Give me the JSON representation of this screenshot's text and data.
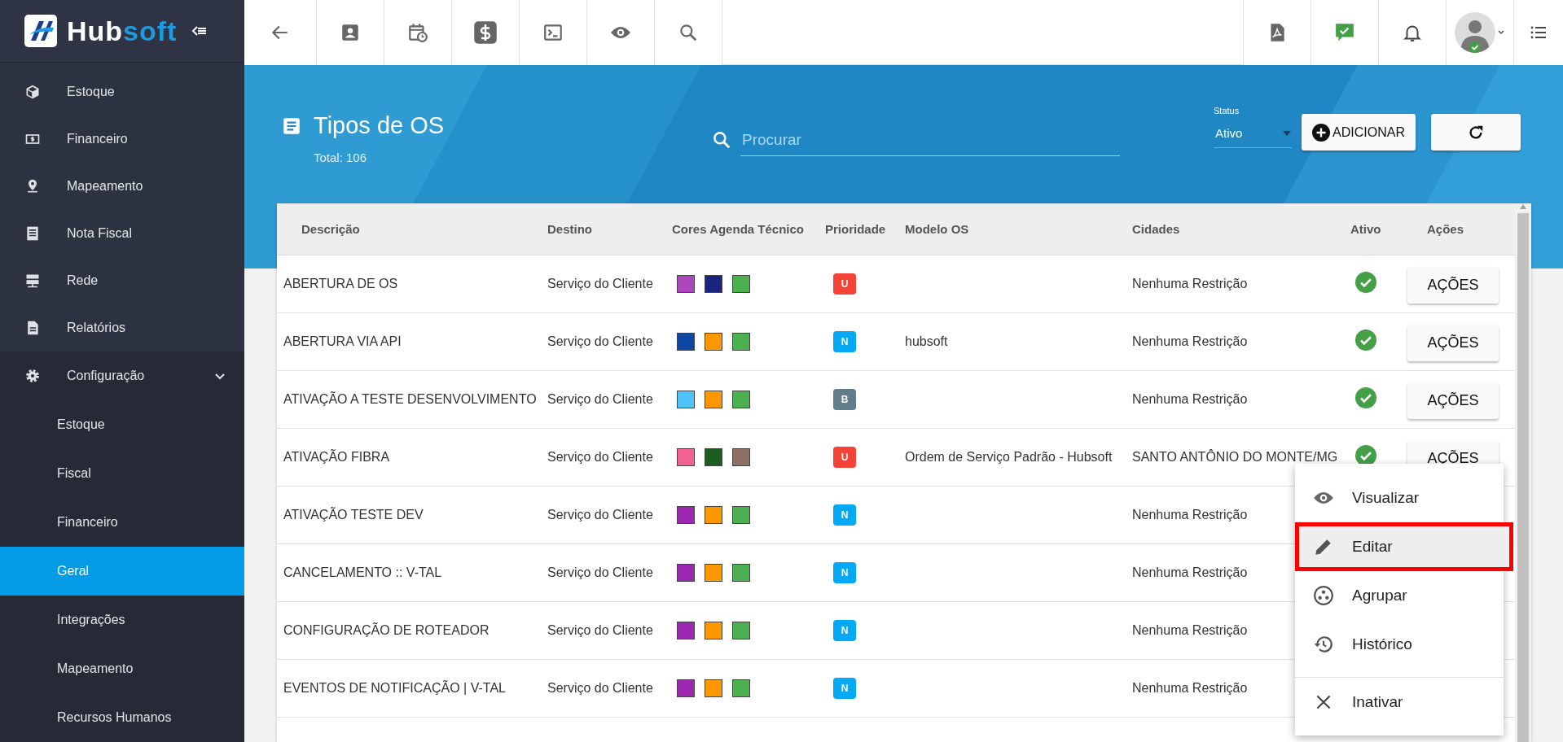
{
  "sidebar": {
    "brand": {
      "part_1": "Hub",
      "part_2": "soft"
    },
    "items": [
      {
        "label": "Estoque",
        "kind": "box",
        "selected": false
      },
      {
        "label": "Financeiro",
        "kind": "money",
        "selected": false
      },
      {
        "label": "Mapeamento",
        "kind": "pin",
        "selected": false
      },
      {
        "label": "Nota Fiscal",
        "kind": "receipt",
        "selected": false
      },
      {
        "label": "Rede",
        "kind": "server",
        "selected": false
      },
      {
        "label": "Relatórios",
        "kind": "doc",
        "selected": false
      },
      {
        "label": "Configuração",
        "kind": "gear",
        "selected": false,
        "expanded": true,
        "children": [
          {
            "label": "Estoque",
            "selected": false
          },
          {
            "label": "Fiscal",
            "selected": false
          },
          {
            "label": "Financeiro",
            "selected": false
          },
          {
            "label": "Geral",
            "selected": true
          },
          {
            "label": "Integrações",
            "selected": false
          },
          {
            "label": "Mapeamento",
            "selected": false
          },
          {
            "label": "Recursos Humanos",
            "selected": false
          }
        ]
      }
    ]
  },
  "header": {
    "title": "Tipos de OS",
    "total": "Total: 106",
    "search": {
      "placeholder": "Procurar"
    },
    "status": {
      "label": "Status",
      "value": "Ativo"
    },
    "add_button": "ADICIONAR"
  },
  "table": {
    "columns": [
      "Descrição",
      "Destino",
      "Cores Agenda Técnico",
      "Prioridade",
      "Modelo OS",
      "Cidades",
      "Ativo",
      "Ações"
    ],
    "rows": [
      {
        "description": "ABERTURA DE OS",
        "destination": "Serviço do Cliente",
        "colors": [
          {
            "color": "#ab47bc"
          },
          {
            "color": "#1a237e"
          },
          {
            "color": "#4caf50"
          }
        ],
        "priority": {
          "label": "U",
          "color": "#f44336"
        },
        "model": "",
        "cities": "Nenhuma Restrição",
        "active": true,
        "action": "AÇÕES"
      },
      {
        "description": "ABERTURA VIA API",
        "destination": "Serviço do Cliente",
        "colors": [
          {
            "color": "#0d47a1"
          },
          {
            "color": "#ff9800"
          },
          {
            "color": "#4caf50"
          }
        ],
        "priority": {
          "label": "N",
          "color": "#03a9f4"
        },
        "model": "hubsoft",
        "cities": "Nenhuma Restrição",
        "active": true,
        "action": "AÇÕES"
      },
      {
        "description": "ATIVAÇÃO A TESTE DESENVOLVIMENTO",
        "destination": "Serviço do Cliente",
        "colors": [
          {
            "color": "#4fc3f7"
          },
          {
            "color": "#ff9800"
          },
          {
            "color": "#4caf50"
          }
        ],
        "priority": {
          "label": "B",
          "color": "#607d8b"
        },
        "model": "",
        "cities": "Nenhuma Restrição",
        "active": true,
        "action": "AÇÕES"
      },
      {
        "description": "ATIVAÇÃO FIBRA",
        "destination": "Serviço do Cliente",
        "colors": [
          {
            "color": "#f06292"
          },
          {
            "color": "#1b5e20"
          },
          {
            "color": "#8d6e63"
          }
        ],
        "priority": {
          "label": "U",
          "color": "#f44336"
        },
        "model": "Ordem de Serviço Padrão - Hubsoft",
        "cities": "SANTO ANTÔNIO DO MONTE/MG",
        "active": true,
        "action": "AÇÕES"
      },
      {
        "description": "ATIVAÇÃO TESTE DEV",
        "destination": "Serviço do Cliente",
        "colors": [
          {
            "color": "#9c27b0"
          },
          {
            "color": "#ff9800"
          },
          {
            "color": "#4caf50"
          }
        ],
        "priority": {
          "label": "N",
          "color": "#03a9f4"
        },
        "model": "",
        "cities": "Nenhuma Restrição"
      },
      {
        "description": "CANCELAMENTO :: V-TAL",
        "destination": "Serviço do Cliente",
        "colors": [
          {
            "color": "#9c27b0"
          },
          {
            "color": "#ff9800"
          },
          {
            "color": "#4caf50"
          }
        ],
        "priority": {
          "label": "N",
          "color": "#03a9f4"
        },
        "model": "",
        "cities": "Nenhuma Restrição"
      },
      {
        "description": "CONFIGURAÇÃO DE ROTEADOR",
        "destination": "Serviço do Cliente",
        "colors": [
          {
            "color": "#9c27b0"
          },
          {
            "color": "#ff9800"
          },
          {
            "color": "#4caf50"
          }
        ],
        "priority": {
          "label": "N",
          "color": "#03a9f4"
        },
        "model": "",
        "cities": "Nenhuma Restrição"
      },
      {
        "description": "EVENTOS DE NOTIFICAÇÃO | V-TAL",
        "destination": "Serviço do Cliente",
        "colors": [
          {
            "color": "#9c27b0"
          },
          {
            "color": "#ff9800"
          },
          {
            "color": "#4caf50"
          }
        ],
        "priority": {
          "label": "N",
          "color": "#03a9f4"
        },
        "model": "",
        "cities": "Nenhuma Restrição"
      }
    ]
  },
  "menu": {
    "items": [
      {
        "label": "Visualizar",
        "kind": "view",
        "highlighted": false,
        "separated": false
      },
      {
        "label": "Editar",
        "kind": "edit",
        "highlighted": true,
        "separated": false
      },
      {
        "label": "Agrupar",
        "kind": "group",
        "highlighted": false,
        "separated": false
      },
      {
        "label": "Histórico",
        "kind": "history",
        "highlighted": false,
        "separated": false
      },
      {
        "label": "Inativar",
        "kind": "deactivate",
        "highlighted": false,
        "separated": true
      }
    ]
  }
}
